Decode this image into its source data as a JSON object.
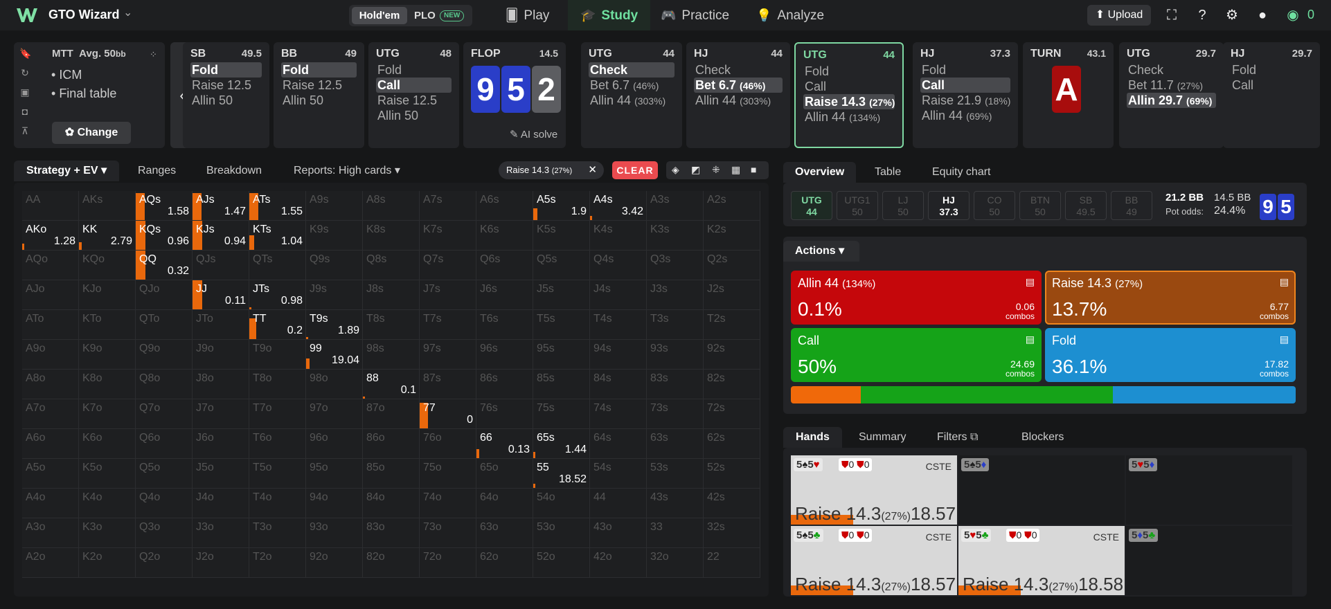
{
  "app": {
    "name": "GTO Wizard"
  },
  "game_toggle": {
    "holdem": "Hold'em",
    "plo": "PLO",
    "new_badge": "NEW"
  },
  "nav": {
    "play": "Play",
    "study": "Study",
    "practice": "Practice",
    "analyze": "Analyze"
  },
  "topbar": {
    "upload": "Upload",
    "coins": "0"
  },
  "format": {
    "title": "MTT",
    "avg": "Avg. 50",
    "avg_unit": "bb",
    "bullets": [
      "ICM",
      "Final table"
    ],
    "change": "Change"
  },
  "nodes": [
    {
      "pos": "SB",
      "stack": "49.5",
      "opts": [
        {
          "t": "Fold",
          "sel": true
        },
        {
          "t": "Raise 12.5"
        },
        {
          "t": "Allin 50"
        }
      ]
    },
    {
      "pos": "BB",
      "stack": "49",
      "opts": [
        {
          "t": "Fold",
          "sel": true
        },
        {
          "t": "Raise 12.5"
        },
        {
          "t": "Allin 50"
        }
      ]
    },
    {
      "pos": "UTG",
      "stack": "48",
      "opts": [
        {
          "t": "Fold"
        },
        {
          "t": "Call",
          "sel": true
        },
        {
          "t": "Raise 12.5"
        },
        {
          "t": "Allin 50"
        }
      ]
    },
    {
      "pos": "UTG",
      "stack": "44",
      "opts": [
        {
          "t": "Check",
          "sel": true
        },
        {
          "t": "Bet 6.7",
          "p": "(46%)"
        },
        {
          "t": "Allin 44",
          "p": "(303%)"
        }
      ]
    },
    {
      "pos": "HJ",
      "stack": "44",
      "opts": [
        {
          "t": "Check"
        },
        {
          "t": "Bet 6.7",
          "p": "(46%)",
          "sel": true
        },
        {
          "t": "Allin 44",
          "p": "(303%)"
        }
      ]
    },
    {
      "pos": "UTG",
      "stack": "44",
      "opts": [
        {
          "t": "Fold"
        },
        {
          "t": "Call"
        },
        {
          "t": "Raise 14.3",
          "p": "(27%)",
          "sel": true
        },
        {
          "t": "Allin 44",
          "p": "(134%)"
        }
      ]
    },
    {
      "pos": "HJ",
      "stack": "37.3",
      "opts": [
        {
          "t": "Fold"
        },
        {
          "t": "Call",
          "sel": true
        },
        {
          "t": "Raise 21.9",
          "p": "(18%)"
        },
        {
          "t": "Allin 44",
          "p": "(69%)"
        }
      ]
    },
    {
      "pos": "UTG",
      "stack": "29.7",
      "opts": [
        {
          "t": "Check"
        },
        {
          "t": "Bet 11.7",
          "p": "(27%)"
        },
        {
          "t": "Allin 29.7",
          "p": "(69%)",
          "sel": true
        }
      ]
    },
    {
      "pos": "HJ",
      "stack": "29.7",
      "opts": [
        {
          "t": "Fold"
        },
        {
          "t": "Call"
        }
      ]
    }
  ],
  "flop": {
    "label": "FLOP",
    "pot": "14.5",
    "cards": [
      "9",
      "5",
      "2"
    ],
    "ai": "AI solve"
  },
  "turn": {
    "label": "TURN",
    "pot": "43.1",
    "card": "A"
  },
  "left_tabs": {
    "strategy": "Strategy + EV",
    "ranges": "Ranges",
    "breakdown": "Breakdown",
    "reports": "Reports: High cards"
  },
  "filter_chip": {
    "label": "Raise 14.3",
    "pct": "(27%)",
    "clear": "CLEAR"
  },
  "grid": {
    "ranks": [
      "A",
      "K",
      "Q",
      "J",
      "T",
      "9",
      "8",
      "7",
      "6",
      "5",
      "4",
      "3",
      "2"
    ],
    "values": {
      "AQs": "1.58",
      "AJs": "1.47",
      "ATs": "1.55",
      "A5s": "1.9",
      "A4s": "3.42",
      "AKo": "1.28",
      "KK": "2.79",
      "KQs": "0.96",
      "KJs": "0.94",
      "KTs": "1.04",
      "QQ": "0.32",
      "JJ": "0.11",
      "JTs": "0.98",
      "TT": "0.2",
      "T9s": "1.89",
      "99": "19.04",
      "88": "0.1",
      "77": "0",
      "66": "0.13",
      "65s": "1.44",
      "55": "18.52"
    },
    "freq": {
      "AQs": 0.9,
      "AJs": 0.9,
      "ATs": 0.9,
      "A5s": 0.4,
      "A4s": 0.15,
      "AKo": 0.2,
      "KK": 0.25,
      "KQs": 1,
      "KJs": 1,
      "KTs": 0.5,
      "QQ": 1,
      "JJ": 1,
      "JTs": 0,
      "TT": 0.7,
      "T9s": 0,
      "99": 0.35,
      "88": 0.05,
      "77": 0.85,
      "66": 0.3,
      "65s": 0.2,
      "55": 0.15
    }
  },
  "overview_tabs": {
    "overview": "Overview",
    "table": "Table",
    "equity": "Equity chart"
  },
  "positions": [
    {
      "p": "UTG",
      "s": "44",
      "state": "active"
    },
    {
      "p": "UTG1",
      "s": "50",
      "state": "out"
    },
    {
      "p": "LJ",
      "s": "50",
      "state": "out"
    },
    {
      "p": "HJ",
      "s": "37.3",
      "state": "live"
    },
    {
      "p": "CO",
      "s": "50",
      "state": "out"
    },
    {
      "p": "BTN",
      "s": "50",
      "state": "out"
    },
    {
      "p": "SB",
      "s": "49.5",
      "state": "out"
    },
    {
      "p": "BB",
      "s": "49",
      "state": "out"
    }
  ],
  "pot": {
    "a": "21.2 BB",
    "b": "14.5 BB",
    "odds_label": "Pot odds:",
    "odds": "24.4%",
    "board": [
      "9",
      "5"
    ]
  },
  "actions_dd": "Actions",
  "actions": [
    {
      "name": "Allin 44",
      "pct": "(134%)",
      "freq": "0.1%",
      "combos": "0.06",
      "color": "#c5070b"
    },
    {
      "name": "Raise 14.3",
      "pct": "(27%)",
      "freq": "13.7%",
      "combos": "6.77",
      "color": "#9a4910"
    },
    {
      "name": "Call",
      "pct": "",
      "freq": "50%",
      "combos": "24.69",
      "color": "#15a318"
    },
    {
      "name": "Fold",
      "pct": "",
      "freq": "36.1%",
      "combos": "17.82",
      "color": "#1d8fd1"
    }
  ],
  "combos_label": "combos",
  "freq_bar": [
    13.8,
    50,
    36.2
  ],
  "hands_tabs": {
    "hands": "Hands",
    "summary": "Summary",
    "filters": "Filters",
    "blockers": "Blockers"
  },
  "hands": [
    {
      "c1": "5",
      "s1": "♠",
      "c2": "5",
      "s2": "♥",
      "b1": "0",
      "b2": "0",
      "tag": "CSTE",
      "action": "Raise 14.3",
      "pct": "(27%)",
      "ev": "18.57",
      "light": true,
      "col": 0,
      "row": 0
    },
    {
      "c1": "5",
      "s1": "♠",
      "c2": "5",
      "s2": "♦",
      "col": 1,
      "row": 0
    },
    {
      "c1": "5",
      "s1": "♥",
      "c2": "5",
      "s2": "♦",
      "col": 2,
      "row": 0
    },
    {
      "c1": "5",
      "s1": "♠",
      "c2": "5",
      "s2": "♣",
      "b1": "0",
      "b2": "0",
      "tag": "CSTE",
      "action": "Raise 14.3",
      "pct": "(27%)",
      "ev": "18.57",
      "light": true,
      "col": 0,
      "row": 1
    },
    {
      "c1": "5",
      "s1": "♥",
      "c2": "5",
      "s2": "♣",
      "b1": "0",
      "b2": "0",
      "tag": "CSTE",
      "action": "Raise 14.3",
      "pct": "(27%)",
      "ev": "18.58",
      "light": true,
      "col": 1,
      "row": 1
    },
    {
      "c1": "5",
      "s1": "♦",
      "c2": "5",
      "s2": "♣",
      "col": 2,
      "row": 1
    }
  ]
}
